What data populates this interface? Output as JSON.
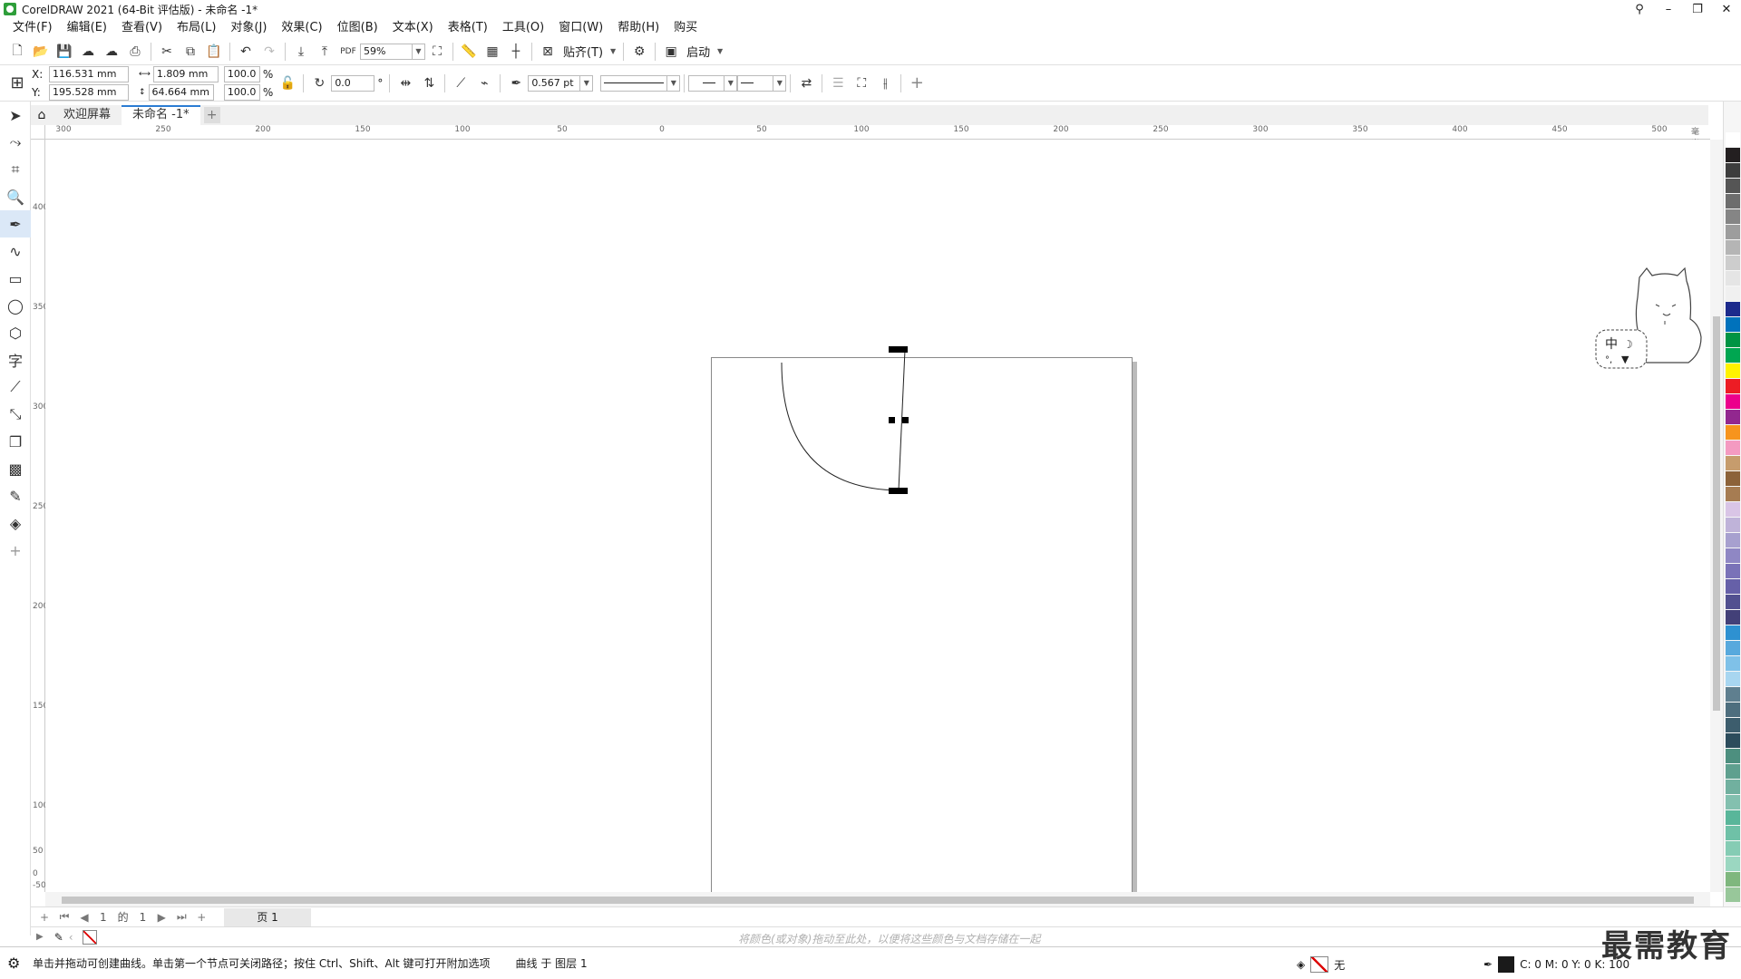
{
  "window": {
    "title": "CorelDRAW 2021 (64-Bit 评估版) - 未命名 -1*",
    "controls": [
      "⚲",
      "–",
      "❐",
      "✕"
    ]
  },
  "menu": [
    "文件(F)",
    "编辑(E)",
    "查看(V)",
    "布局(L)",
    "对象(J)",
    "效果(C)",
    "位图(B)",
    "文本(X)",
    "表格(T)",
    "工具(O)",
    "窗口(W)",
    "帮助(H)",
    "购买"
  ],
  "standard_toolbar": {
    "zoom": "59%",
    "snap_label": "贴齐(T)",
    "launch_label": "启动"
  },
  "property_bar": {
    "x_label": "X:",
    "x_value": "116.531 mm",
    "y_label": "Y:",
    "y_value": "195.528 mm",
    "width_value": "1.809 mm",
    "height_value": "64.664 mm",
    "scale_w": "100.0",
    "scale_h": "100.0",
    "pct": "%",
    "rotation": "0.0",
    "deg": "°",
    "outline_width": "0.567 pt"
  },
  "tabs": [
    {
      "label": "欢迎屏幕",
      "active": false
    },
    {
      "label": "未命名 -1*",
      "active": true
    }
  ],
  "ruler": {
    "h_labels": [
      "300",
      "250",
      "200",
      "150",
      "100",
      "50",
      "0",
      "50",
      "100",
      "150",
      "200",
      "250",
      "300",
      "350",
      "400",
      "450",
      "500"
    ],
    "unit": "毫米",
    "v_labels": [
      "400",
      "350",
      "300",
      "250",
      "200",
      "150",
      "100",
      "50",
      "0",
      "-50"
    ]
  },
  "page_nav": {
    "current": "1",
    "of_label": "的",
    "total": "1",
    "page_tab": "页 1"
  },
  "doc_palette_hint": "将颜色(或对象)拖动至此处，以便将这些颜色与文档存储在一起",
  "status": {
    "message": "单击并拖动可创建曲线。单击第一个节点可关闭路径；按住 Ctrl、Shift、Alt 键可打开附加选项",
    "object": "曲线 于 图层 1",
    "fill_label": "无",
    "outline_cmyk": "C: 0 M: 0 Y: 0 K: 100"
  },
  "sticker_text": "中",
  "watermark": "最需教育",
  "palette_colors": [
    "#ffffff",
    "#231f20",
    "#3d3d3d",
    "#555555",
    "#6d6d6d",
    "#858585",
    "#9d9d9d",
    "#b5b5b5",
    "#cdcdcd",
    "#e5e5e5",
    "#f0f0f0",
    "#1c2a8c",
    "#0072bc",
    "#009444",
    "#00a651",
    "#fff200",
    "#ed1c24",
    "#ec008c",
    "#92278f",
    "#f7941d",
    "#f49ac1",
    "#c69c6d",
    "#8c6239",
    "#a67c52",
    "#d9c5e6",
    "#bfb3d9",
    "#a7a0cf",
    "#8f87c4",
    "#7a72b8",
    "#6660a8",
    "#525090",
    "#434078",
    "#2e91d1",
    "#58a9dd",
    "#7fc1e8",
    "#a8d6f0",
    "#5f7f8f",
    "#4e6e7e",
    "#3d5d6d",
    "#2c4c5c",
    "#4d8f7f",
    "#5fa08f",
    "#71b09f",
    "#83c0af",
    "#59b69a",
    "#6fc1a7",
    "#85ccb4",
    "#9bd7c1",
    "#7fb77e",
    "#98c79a"
  ]
}
